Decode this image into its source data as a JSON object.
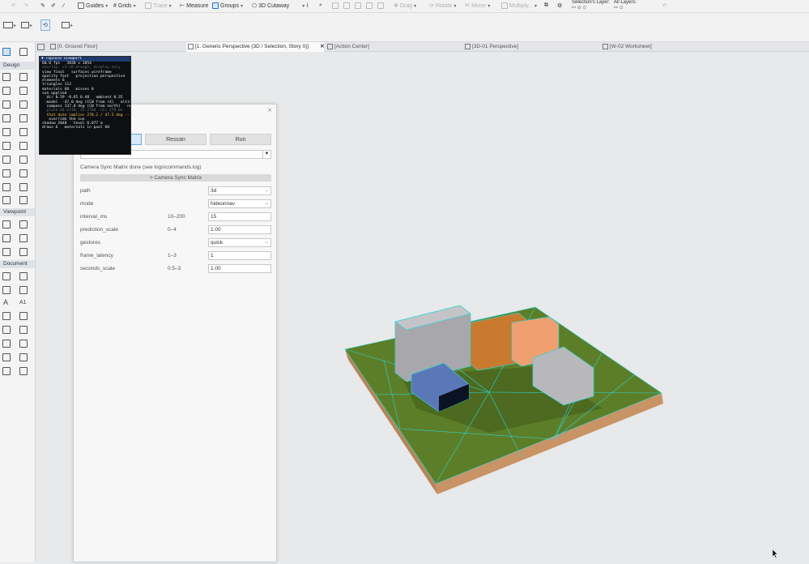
{
  "toolbar": {
    "guides": "Guides",
    "grids": "Grids",
    "trace": "Trace",
    "measure": "Measure",
    "groups": "Groups",
    "cutaway": "3D Cutaway",
    "drag": "Drag",
    "rotate": "Rotate",
    "mirror": "Mirror",
    "multiply": "Multiply...",
    "selection_layer": "Selection's Layer:",
    "all_layers": "All Layers:"
  },
  "toolbox": {
    "design": "Design",
    "viewpoint": "Viewpoint",
    "document": "Document",
    "doc_label_a": "A",
    "doc_label_a1": "A1"
  },
  "tabs": [
    {
      "label": "[0. Ground Floor]"
    },
    {
      "label": "[1. Generic Perspective (3D / Selection, Story 0)]",
      "close": "✕"
    },
    {
      "label": "[Action Center]"
    },
    {
      "label": "[3D-01 Perspective]"
    },
    {
      "label": "[W-02 Worksheet]"
    }
  ],
  "overlay": {
    "header": "▼ Topcoco viewport",
    "lines": [
      {
        "text": "60.0 fps   3038 x 1054",
        "cls": ""
      },
      {
        "text": "overlay: c1-c6-drough, display only",
        "cls": "dim"
      },
      {
        "text": "view final   surfaces wireframe",
        "cls": ""
      },
      {
        "text": "quality fast   projection perspective",
        "cls": ""
      },
      {
        "text": "elements 6",
        "cls": ""
      },
      {
        "text": "triangles 112",
        "cls": ""
      },
      {
        "text": "materials 60   misses 0",
        "cls": ""
      },
      {
        "text": "sun applied",
        "cls": ""
      },
      {
        "text": "  dir 0.59 -0.65 0.48   ambient 0.35",
        "cls": ""
      },
      {
        "text": "  model  -47.0 deg (CCW from +X)   altitude",
        "cls": ""
      },
      {
        "text": "  compass 137.0 deg (CW from north)   north",
        "cls": ""
      },
      {
        "text": "  place 64.6738, 25.2760  utc 179 mn   TMU",
        "cls": "dim"
      },
      {
        "text": "  that date implies 270.2 / 47.5 deg -- 57",
        "cls": "org"
      },
      {
        "text": "   override the sun",
        "cls": ""
      },
      {
        "text": "shadow 2048   texel 0.077 m",
        "cls": ""
      },
      {
        "text": "draws 6   materials in pool 60",
        "cls": ""
      }
    ]
  },
  "dialog": {
    "close": "×",
    "buttons": {
      "rescan": "Rescan",
      "run": "Run"
    },
    "combo_dd": "▼",
    "status": "Camera Sync Matrix done (see logs\\commands.log)",
    "section": "> Camera Sync Matrix",
    "params": [
      {
        "label": "path",
        "range": "",
        "value": "3d",
        "dropdown": true
      },
      {
        "label": "mode",
        "range": "",
        "value": "hideonnav",
        "dropdown": true
      },
      {
        "label": "interval_ms",
        "range": "10–200",
        "value": "15",
        "dropdown": false
      },
      {
        "label": "prediction_scale",
        "range": "0–4",
        "value": "1.00",
        "dropdown": false
      },
      {
        "label": "gestures",
        "range": "",
        "value": "quick",
        "dropdown": true
      },
      {
        "label": "frame_latency",
        "range": "1–3",
        "value": "1",
        "dropdown": false
      },
      {
        "label": "seconds_scale",
        "range": "0.5–3",
        "value": "1.00",
        "dropdown": false
      }
    ]
  },
  "colors": {
    "ground": "#5f7f2a",
    "ground_side": "#c08a5c",
    "wire": "#2bd6d6",
    "block_gray": "#b8b8bc",
    "block_orange": "#d98a3a",
    "block_peach": "#f4a77a",
    "block_blue": "#6a88c8"
  }
}
